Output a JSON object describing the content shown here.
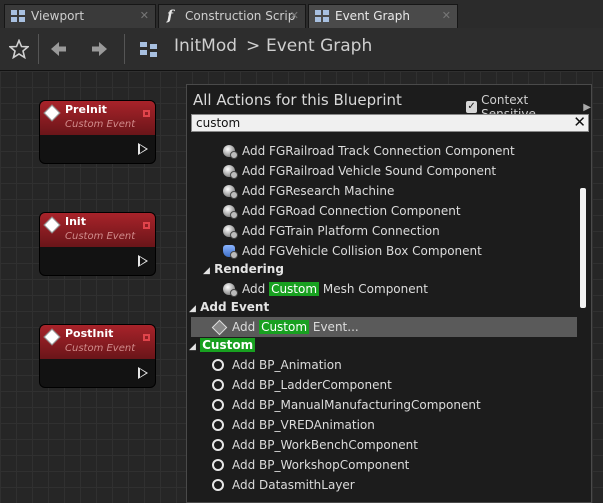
{
  "tabs": [
    {
      "label": "Viewport",
      "icon": "viewport-grid-icon",
      "close": "✕"
    },
    {
      "label": "Construction Scrip",
      "icon": "function-icon",
      "close": "✕"
    },
    {
      "label": "Event Graph",
      "icon": "event-graph-grid-icon",
      "close": "✕"
    }
  ],
  "toolbar": {
    "breadcrumb_root": "InitMod",
    "breadcrumb_sep": ">",
    "breadcrumb_current": "Event Graph"
  },
  "nodes": [
    {
      "title": "PreInit",
      "subtitle": "Custom Event"
    },
    {
      "title": "Init",
      "subtitle": "Custom Event"
    },
    {
      "title": "PostInit",
      "subtitle": "Custom Event"
    }
  ],
  "menu": {
    "title": "All Actions for this Blueprint",
    "context_sensitive_label": "Context Sensitive",
    "context_sensitive_checked": true,
    "search_value": "custom",
    "items": [
      "Add FGRailroad Track Connection Component",
      "Add FGRailroad Vehicle Sound Component",
      "Add FGResearch Machine",
      "Add FGRoad Connection Component",
      "Add FGTrain Platform Connection",
      "Add FGVehicle Collision Box Component"
    ],
    "rendering_category": "Rendering",
    "mesh_prefix": "Add",
    "mesh_highlight": "Custom",
    "mesh_suffix": "Mesh Component",
    "add_event_category": "Add Event",
    "event_prefix": "Add",
    "event_highlight": "Custom",
    "event_suffix": "Event...",
    "custom_category": "Custom",
    "custom_items": [
      "Add BP_Animation",
      "Add BP_LadderComponent",
      "Add BP_ManualManufacturingComponent",
      "Add BP_VREDAnimation",
      "Add BP_WorkBenchComponent",
      "Add BP_WorkshopComponent",
      "Add DatasmithLayer"
    ]
  },
  "colors": {
    "node_header": "#a8232a",
    "search_highlight": "#18a020",
    "selected_row": "#5a5a5a"
  }
}
